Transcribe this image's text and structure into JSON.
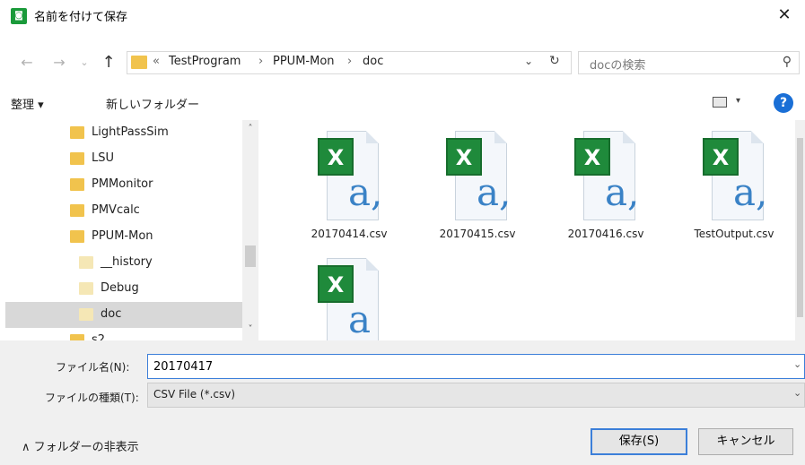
{
  "window": {
    "title": "名前を付けて保存",
    "close": "✕"
  },
  "nav": {
    "back": "←",
    "forward": "→",
    "recent": "⌄",
    "up": "↑",
    "overflow": "«",
    "breadcrumbs": [
      "TestProgram",
      "PPUM-Mon",
      "doc"
    ],
    "separator": "›",
    "dropdown": "⌄",
    "refresh": "↻",
    "search_placeholder": "docの検索",
    "search_icon": "⚲"
  },
  "toolbar": {
    "organize": "整理 ▾",
    "new_folder": "新しいフォルダー",
    "view_dropdown": "▾",
    "help": "?"
  },
  "tree": {
    "scroll_up": "˄",
    "scroll_down": "˅",
    "items": [
      {
        "label": "LightPassSim",
        "indent": 0,
        "selected": false
      },
      {
        "label": "LSU",
        "indent": 0,
        "selected": false
      },
      {
        "label": "PMMonitor",
        "indent": 0,
        "selected": false
      },
      {
        "label": "PMVcalc",
        "indent": 0,
        "selected": false
      },
      {
        "label": "PPUM-Mon",
        "indent": 0,
        "selected": false
      },
      {
        "label": "__history",
        "indent": 1,
        "selected": false
      },
      {
        "label": "Debug",
        "indent": 1,
        "selected": false
      },
      {
        "label": "doc",
        "indent": 1,
        "selected": true
      },
      {
        "label": "s2",
        "indent": 0,
        "selected": false
      }
    ]
  },
  "files": [
    {
      "name": "20170414.csv",
      "icon_letter": "X",
      "type_letter": "a,"
    },
    {
      "name": "20170415.csv",
      "icon_letter": "X",
      "type_letter": "a,"
    },
    {
      "name": "20170416.csv",
      "icon_letter": "X",
      "type_letter": "a,"
    },
    {
      "name": "TestOutput.csv",
      "icon_letter": "X",
      "type_letter": "a,"
    },
    {
      "name": "",
      "icon_letter": "X",
      "type_letter": "a"
    }
  ],
  "form": {
    "filename_label": "ファイル名(N):",
    "filename_value": "20170417",
    "filename_dropdown": "⌄",
    "filetype_label": "ファイルの種類(T):",
    "filetype_value": "CSV File (*.csv)",
    "filetype_dropdown": "⌄",
    "hide_folders": "∧ フォルダーの非表示",
    "save": "保存(S)",
    "cancel": "キャンセル"
  },
  "colors": {
    "accent": "#3c7fd9",
    "folder": "#f1c34d",
    "excel_green": "#1f8a3b",
    "help_blue": "#1a6fd6"
  }
}
